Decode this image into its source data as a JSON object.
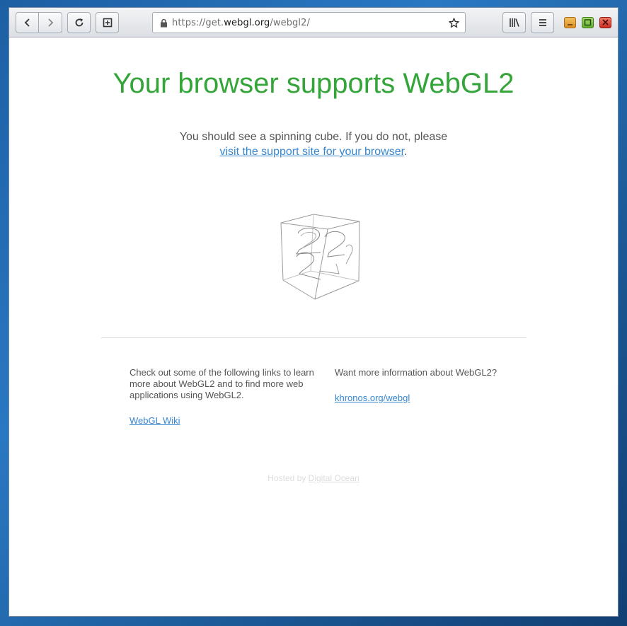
{
  "browser": {
    "url_prefix": "https://get.",
    "url_domain": "webgl.org",
    "url_path": "/webgl2/",
    "icons": {
      "back": "chevron-left-icon",
      "forward": "chevron-right-icon",
      "reload": "reload-icon",
      "new_tab": "new-tab-icon",
      "lock": "lock-icon",
      "bookmark": "star-icon",
      "library": "library-icon",
      "menu": "hamburger-menu-icon"
    },
    "window_controls": {
      "minimize_color": "#e9a23b",
      "maximize_color": "#7bc142",
      "close_color": "#d9443a"
    }
  },
  "page": {
    "headline": "Your browser supports WebGL2",
    "headline_color": "#34a538",
    "lead_text": "You should see a spinning cube. If you do not, please",
    "support_link": "visit the support site for your browser",
    "lead_end": ".",
    "left_column": {
      "text": "Check out some of the following links to learn more about WebGL2 and to find more web applications using WebGL2.",
      "link": "WebGL Wiki"
    },
    "right_column": {
      "text": "Want more information about WebGL2?",
      "link": "khronos.org/webgl"
    },
    "footer": {
      "prefix": "Hosted by",
      "link": "Digital Ocean"
    },
    "link_color": "#3787d0"
  }
}
